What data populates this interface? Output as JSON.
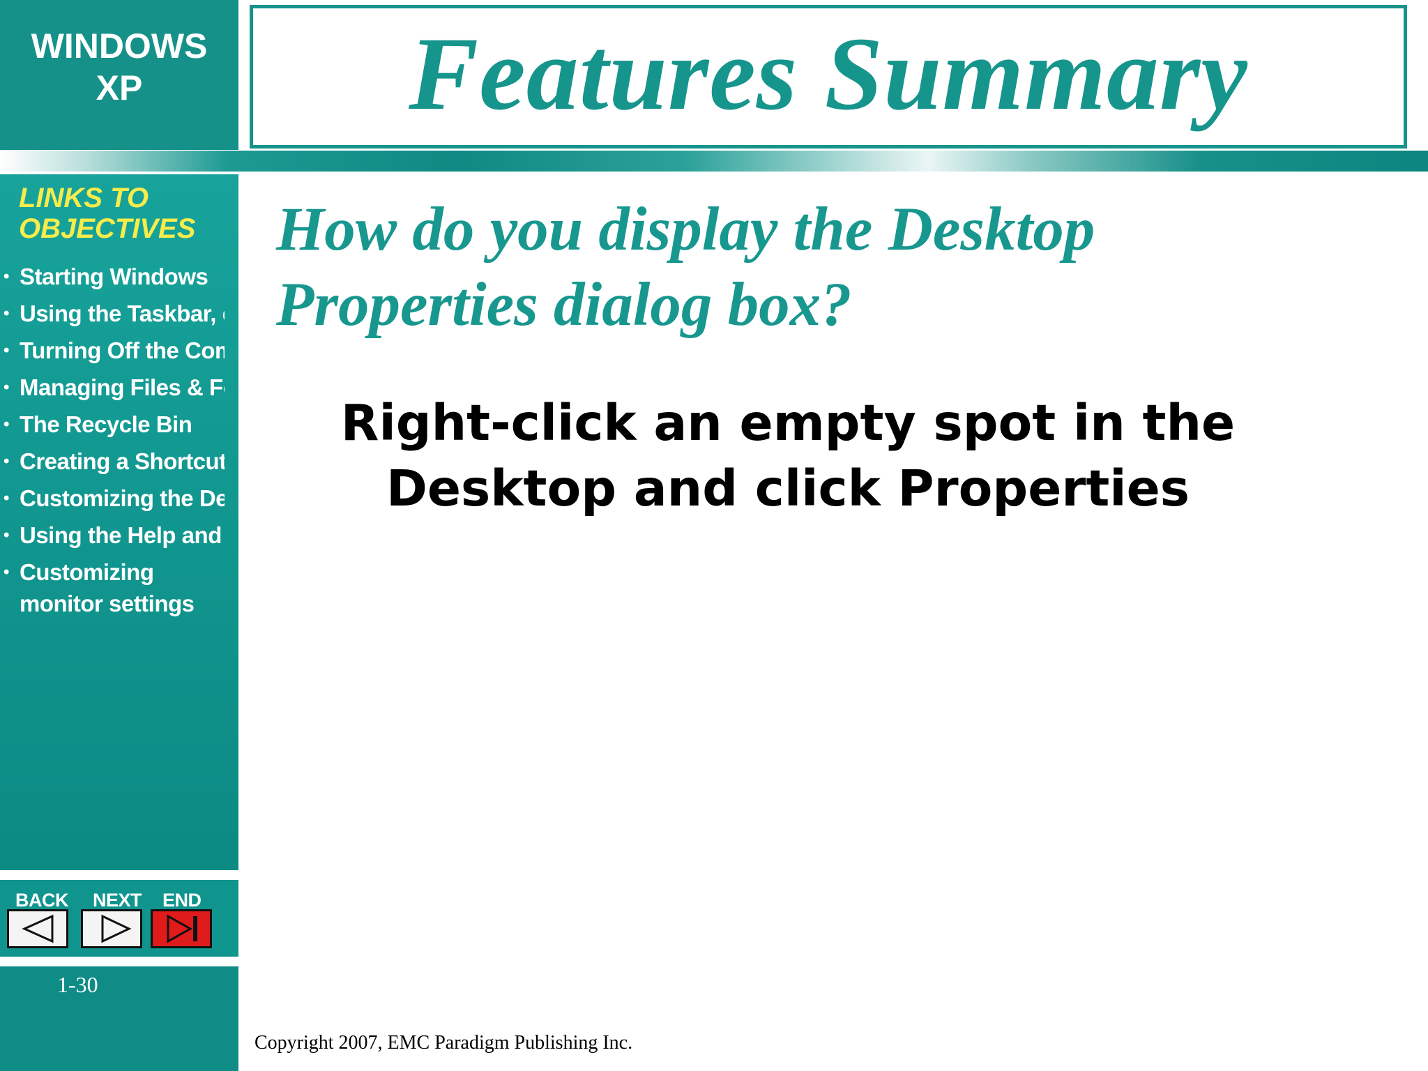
{
  "brand": {
    "line1": "WINDOWS",
    "line2": "XP"
  },
  "title": "Features Summary",
  "sidebar": {
    "links_title_line1": "LINKS TO",
    "links_title_line2": "OBJECTIVES",
    "items": [
      {
        "label": "Starting Windows"
      },
      {
        "label": "Using the Taskbar, o"
      },
      {
        "label": "Turning Off the Comp"
      },
      {
        "label": "Managing Files & Fol"
      },
      {
        "label": "The Recycle Bin"
      },
      {
        "label": "Creating a Shortcut"
      },
      {
        "label": "Customizing the Des"
      },
      {
        "label": "Using the Help and S"
      },
      {
        "label": "Customizing monitor settings"
      }
    ]
  },
  "nav": {
    "back": "BACK",
    "next": "NEXT",
    "end": "END"
  },
  "slide_number": "1-30",
  "question": {
    "line1": "How do you display the Desktop",
    "line2": "Properties dialog box?"
  },
  "answer": {
    "line1": "Right-click an empty spot in the",
    "line2": "Desktop and click Properties"
  },
  "copyright": "Copyright 2007, EMC Paradigm Publishing Inc.",
  "colors": {
    "teal": "#16948c",
    "sidebar_text_yellow": "#f6ec4b",
    "end_button_red": "#e01b1b"
  },
  "icons": {
    "back": "triangle-left-icon",
    "next": "triangle-right-icon",
    "end": "skip-to-end-icon"
  }
}
